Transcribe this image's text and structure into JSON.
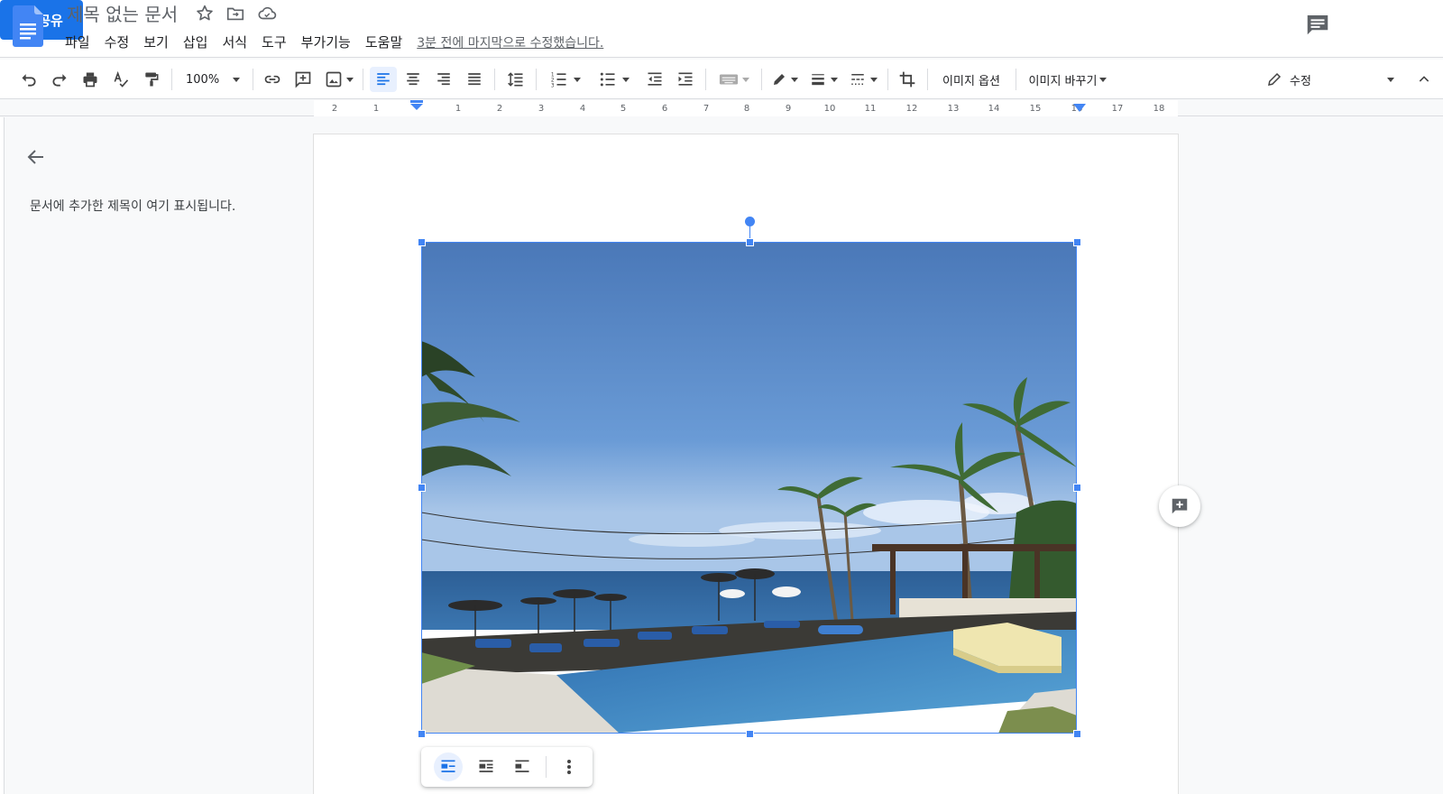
{
  "app": {
    "doc_title": "제목 없는 문서",
    "last_edit": "3분 전에 마지막으로 수정했습니다.",
    "share_label": "공유",
    "accent_color": "#1a73e8"
  },
  "menu": {
    "items": [
      {
        "label": "파일"
      },
      {
        "label": "수정"
      },
      {
        "label": "보기"
      },
      {
        "label": "삽입"
      },
      {
        "label": "서식"
      },
      {
        "label": "도구"
      },
      {
        "label": "부가기능"
      },
      {
        "label": "도움말"
      }
    ]
  },
  "toolbar": {
    "zoom": "100%",
    "image_options": "이미지 옵션",
    "replace_image": "이미지 바꾸기",
    "mode": "수정"
  },
  "ruler": {
    "labels": [
      "2",
      "1",
      "1",
      "2",
      "3",
      "4",
      "5",
      "6",
      "7",
      "8",
      "9",
      "10",
      "11",
      "12",
      "13",
      "14",
      "15",
      "16",
      "17",
      "18"
    ]
  },
  "outline": {
    "hint": "문서에 추가한 제목이 여기 표시됩니다."
  },
  "image": {
    "description_icon": "photo-beach-pool"
  }
}
